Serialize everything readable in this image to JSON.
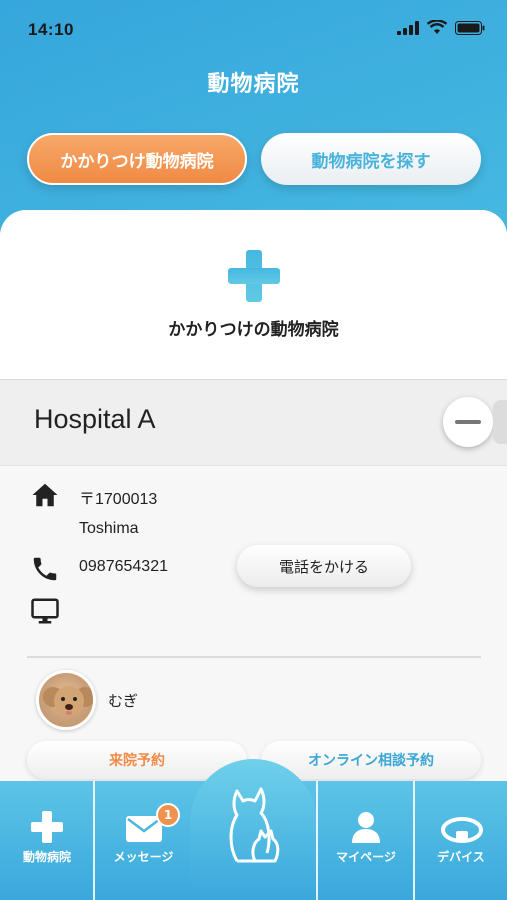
{
  "status": {
    "time": "14:10"
  },
  "header": {
    "title": "動物病院"
  },
  "segments": {
    "primary": "かかりつけ動物病院",
    "secondary": "動物病院を探す"
  },
  "card": {
    "title": "かかりつけの動物病院",
    "hospital_name": "Hospital A",
    "postal_code": "〒1700013",
    "address": "Toshima",
    "phone": "0987654321",
    "call_label": "電話をかける"
  },
  "pet": {
    "name": "むぎ"
  },
  "actions": {
    "visit": "来院予約",
    "online": "オンライン相談予約"
  },
  "nav": {
    "items": [
      {
        "label": "動物病院",
        "icon": "plus-icon"
      },
      {
        "label": "メッセージ",
        "icon": "mail-icon",
        "badge": "1"
      },
      {
        "label": "",
        "icon": "pet-logo-icon"
      },
      {
        "label": "マイページ",
        "icon": "person-icon"
      },
      {
        "label": "デバイス",
        "icon": "collar-icon"
      }
    ]
  },
  "colors": {
    "accent_blue": "#3aa8dc",
    "accent_orange": "#f08a45"
  }
}
